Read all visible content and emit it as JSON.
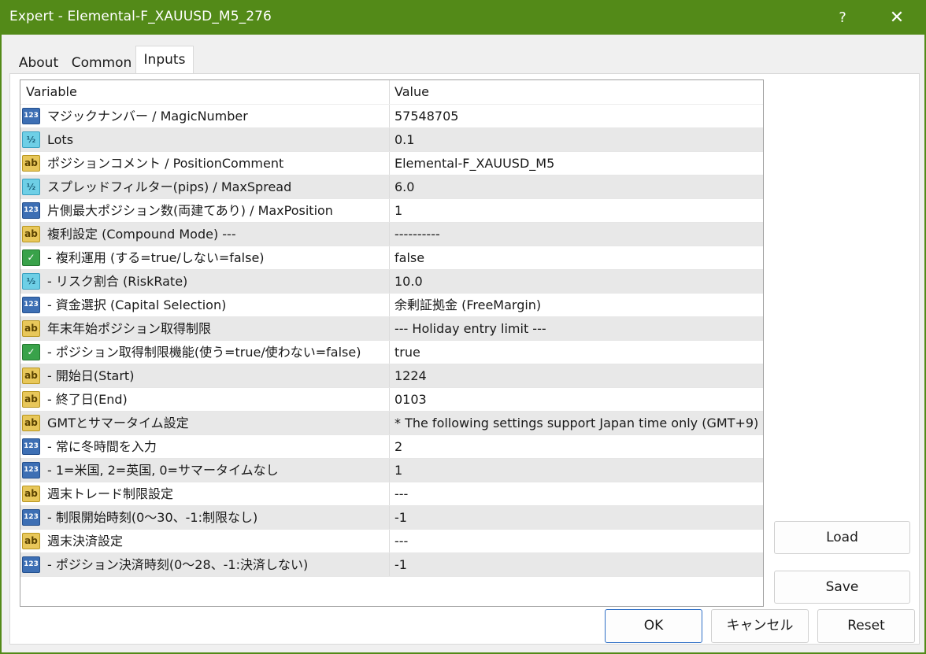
{
  "window": {
    "title": "Expert - Elemental-F_XAUUSD_M5_276",
    "help_label": "?",
    "close_label": "✕"
  },
  "tabs": [
    {
      "label": "About"
    },
    {
      "label": "Common"
    },
    {
      "label": "Inputs"
    }
  ],
  "grid": {
    "headers": {
      "variable": "Variable",
      "value": "Value"
    },
    "rows": [
      {
        "type": "int",
        "variable": "マジックナンバー / MagicNumber",
        "value": "57548705"
      },
      {
        "type": "double",
        "variable": "Lots",
        "value": "0.1"
      },
      {
        "type": "string",
        "variable": "ポジションコメント / PositionComment",
        "value": "Elemental-F_XAUUSD_M5"
      },
      {
        "type": "double",
        "variable": "スプレッドフィルター(pips) / MaxSpread",
        "value": "6.0"
      },
      {
        "type": "int",
        "variable": "片側最大ポジション数(両建てあり) / MaxPosition",
        "value": "1"
      },
      {
        "type": "string",
        "variable": "複利設定 (Compound Mode) ---",
        "value": "----------"
      },
      {
        "type": "bool",
        "variable": "- 複利運用 (する=true/しない=false)",
        "value": "false"
      },
      {
        "type": "double",
        "variable": "- リスク割合 (RiskRate)",
        "value": "10.0"
      },
      {
        "type": "int",
        "variable": "- 資金選択 (Capital Selection)",
        "value": "余剰証拠金 (FreeMargin)"
      },
      {
        "type": "string",
        "variable": "年末年始ポジション取得制限",
        "value": "--- Holiday entry limit ---"
      },
      {
        "type": "bool",
        "variable": "- ポジション取得制限機能(使う=true/使わない=false)",
        "value": "true"
      },
      {
        "type": "string",
        "variable": "- 開始日(Start)",
        "value": "1224"
      },
      {
        "type": "string",
        "variable": "- 終了日(End)",
        "value": "0103"
      },
      {
        "type": "string",
        "variable": "GMTとサマータイム設定",
        "value": "* The following settings support Japan time only (GMT+9)"
      },
      {
        "type": "int",
        "variable": "- 常に冬時間を入力",
        "value": "2"
      },
      {
        "type": "int",
        "variable": "- 1=米国, 2=英国, 0=サマータイムなし",
        "value": "1"
      },
      {
        "type": "string",
        "variable": "週末トレード制限設定",
        "value": "---"
      },
      {
        "type": "int",
        "variable": "- 制限開始時刻(0〜30、-1:制限なし)",
        "value": "-1"
      },
      {
        "type": "string",
        "variable": "週末決済設定",
        "value": "---"
      },
      {
        "type": "int",
        "variable": "- ポジション決済時刻(0〜28、-1:決済しない)",
        "value": "-1"
      }
    ]
  },
  "icons": {
    "int": {
      "name": "integer-type-icon",
      "glyph": "123"
    },
    "double": {
      "name": "double-type-icon",
      "glyph": "½"
    },
    "string": {
      "name": "string-type-icon",
      "glyph": "ab"
    },
    "bool": {
      "name": "bool-type-icon",
      "glyph": "✓"
    }
  },
  "buttons": {
    "load": "Load",
    "save": "Save",
    "ok": "OK",
    "cancel": "キャンセル",
    "reset": "Reset"
  },
  "colors": {
    "titlebar": "#538a18",
    "ok_border": "#2f6fc6"
  }
}
